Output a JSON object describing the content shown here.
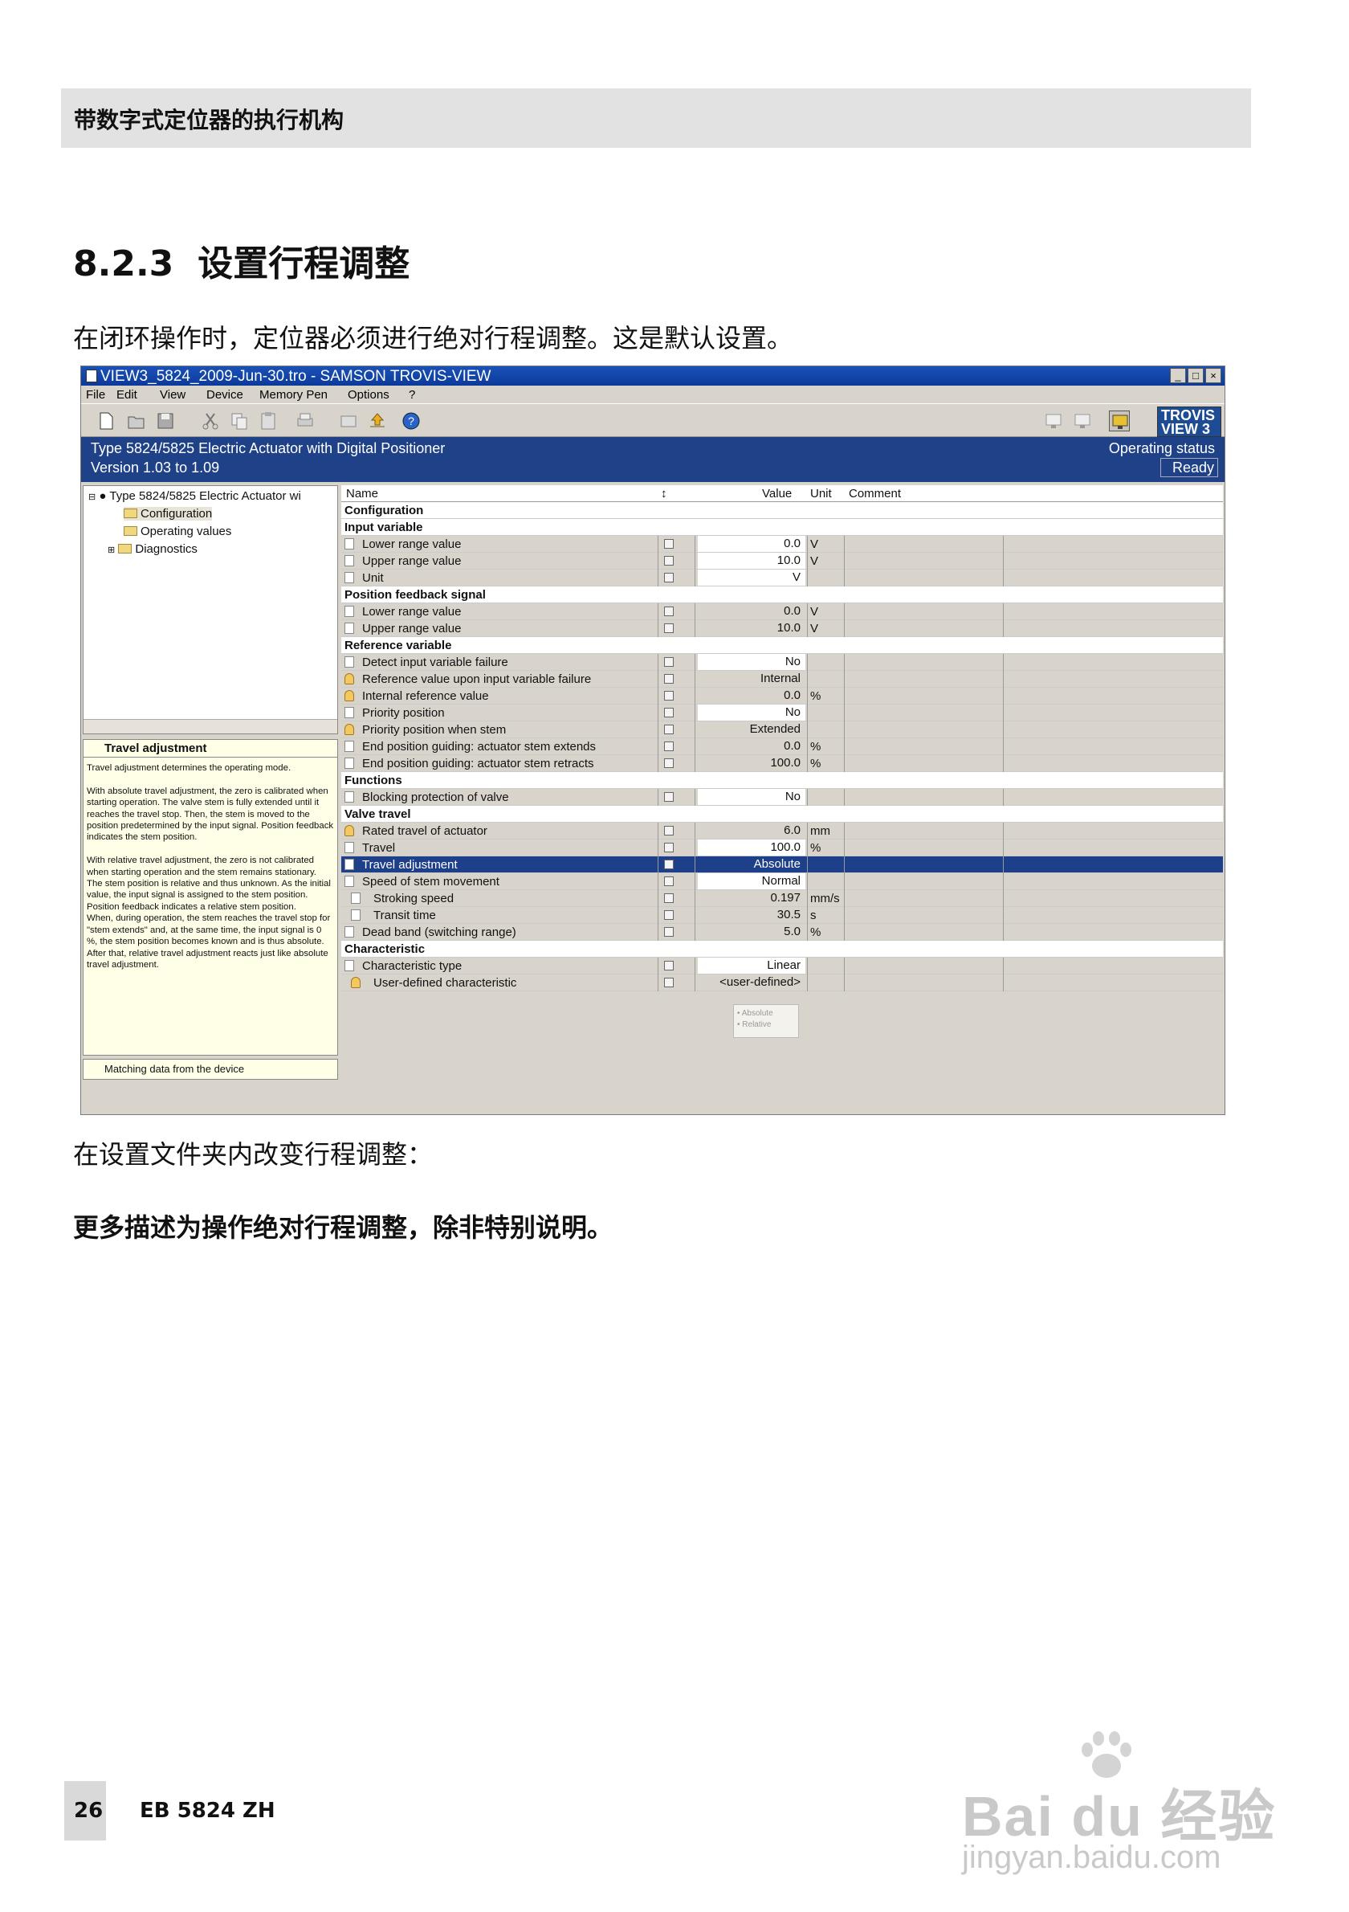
{
  "header": {
    "title": "带数字式定位器的执行机构"
  },
  "section": {
    "number": "8.2.3",
    "title": "设置行程调整"
  },
  "intro": "在闭环操作时，定位器必须进行绝对行程调整。这是默认设置。",
  "after_text": "在设置文件夹内改变行程调整：",
  "bold_note": "更多描述为操作绝对行程调整，除非特别说明。",
  "footer": {
    "page": "26",
    "doc": "EB 5824 ZH"
  },
  "watermark": {
    "line1": "Bai du 经验",
    "line2": "jingyan.baidu.com"
  },
  "window": {
    "title": "VIEW3_5824_2009-Jun-30.tro - SAMSON TROVIS-VIEW",
    "buttons": [
      "_",
      "□",
      "×"
    ],
    "menu": [
      "File",
      "Edit",
      "View",
      "Device",
      "Memory Pen",
      "Options",
      "?"
    ],
    "toolbar_icons": [
      "new-icon",
      "open-icon",
      "save-icon",
      "cut-icon",
      "copy-icon",
      "paste-icon",
      "print-icon",
      "tool-icon",
      "upload-icon",
      "help-icon",
      "monitor-icon",
      "monitor-icon",
      "monitor-active-icon"
    ],
    "logo": "TROVIS VIEW 3",
    "device_line1": "Type 5824/5825 Electric Actuator with Digital Positioner",
    "device_line2": "Version 1.03 to 1.09",
    "status_label": "Operating status",
    "status_value": "Ready",
    "tree": {
      "root": "Type 5824/5825 Electric Actuator wi",
      "items": [
        "Configuration",
        "Operating values",
        "Diagnostics"
      ]
    },
    "help": {
      "title": "Travel adjustment",
      "body": "Travel adjustment determines the operating mode.\n\nWith absolute travel adjustment, the zero is calibrated when starting operation. The valve stem is fully extended until it reaches the travel stop. Then, the stem is moved to the position predetermined by the input signal. Position feedback indicates the stem position.\n\nWith relative travel adjustment, the zero is not calibrated when starting operation and the stem remains stationary. The stem position is relative and thus unknown. As the initial value, the input signal is assigned to the stem position. Position feedback indicates a relative stem position.\nWhen, during operation, the stem reaches the travel stop for \"stem extends\" and, at the same time, the input signal is 0 %, the stem position becomes known and is thus absolute. After that, relative travel adjustment reacts just like absolute travel adjustment.",
      "footer": "Matching data from the device"
    },
    "columns": {
      "name": "Name",
      "sort": "↕",
      "value": "Value",
      "unit": "Unit",
      "comment": "Comment"
    },
    "rows": [
      {
        "type": "sec",
        "name": "Configuration"
      },
      {
        "type": "sec",
        "name": "Input variable"
      },
      {
        "type": "item",
        "name": "Lower range value",
        "value": "0.0",
        "unit": "V",
        "white": true
      },
      {
        "type": "item",
        "name": "Upper range value",
        "value": "10.0",
        "unit": "V",
        "white": true
      },
      {
        "type": "item",
        "name": "Unit",
        "value": "V",
        "unit": "",
        "white": true
      },
      {
        "type": "sec",
        "name": "Position feedback signal"
      },
      {
        "type": "item",
        "name": "Lower range value",
        "value": "0.0",
        "unit": "V",
        "white": false
      },
      {
        "type": "item",
        "name": "Upper range value",
        "value": "10.0",
        "unit": "V",
        "white": false
      },
      {
        "type": "sec",
        "name": "Reference variable"
      },
      {
        "type": "item",
        "name": "Detect input variable failure",
        "value": "No",
        "unit": "",
        "white": true
      },
      {
        "type": "item",
        "name": "Reference value upon input variable failure",
        "value": "Internal",
        "unit": "",
        "white": false,
        "lock": true
      },
      {
        "type": "item",
        "name": "Internal reference value",
        "value": "0.0",
        "unit": "%",
        "white": false,
        "lock": true
      },
      {
        "type": "item",
        "name": "Priority position",
        "value": "No",
        "unit": "",
        "white": true
      },
      {
        "type": "item",
        "name": "Priority position when stem",
        "value": "Extended",
        "unit": "",
        "white": false,
        "lock": true
      },
      {
        "type": "item",
        "name": "End position guiding: actuator stem extends",
        "value": "0.0",
        "unit": "%",
        "white": false
      },
      {
        "type": "item",
        "name": "End position guiding: actuator stem retracts",
        "value": "100.0",
        "unit": "%",
        "white": false
      },
      {
        "type": "sec",
        "name": "Functions"
      },
      {
        "type": "item",
        "name": "Blocking protection of valve",
        "value": "No",
        "unit": "",
        "white": true
      },
      {
        "type": "sec",
        "name": "Valve travel"
      },
      {
        "type": "item",
        "name": "Rated travel of actuator",
        "value": "6.0",
        "unit": "mm",
        "white": false,
        "lock": true
      },
      {
        "type": "item",
        "name": "Travel",
        "value": "100.0",
        "unit": "%",
        "white": true
      },
      {
        "type": "item",
        "name": "Travel adjustment",
        "value": "Absolute",
        "unit": "",
        "hl": true
      },
      {
        "type": "item",
        "name": "Speed of stem movement",
        "value": "Normal",
        "unit": "",
        "white": true
      },
      {
        "type": "item",
        "name": "Stroking speed",
        "value": "0.197",
        "unit": "mm/s",
        "white": false,
        "sub": true
      },
      {
        "type": "item",
        "name": "Transit time",
        "value": "30.5",
        "unit": "s",
        "white": false,
        "sub": true
      },
      {
        "type": "item",
        "name": "Dead band (switching range)",
        "value": "5.0",
        "unit": "%",
        "white": false
      },
      {
        "type": "sec",
        "name": "Characteristic"
      },
      {
        "type": "item",
        "name": "Characteristic type",
        "value": "Linear",
        "unit": "",
        "white": true
      },
      {
        "type": "item",
        "name": "User-defined characteristic",
        "value": "<user-defined>",
        "unit": "",
        "white": false,
        "lock": true,
        "sub": true
      }
    ],
    "tooltip": [
      "• Absolute",
      "• Relative"
    ]
  }
}
